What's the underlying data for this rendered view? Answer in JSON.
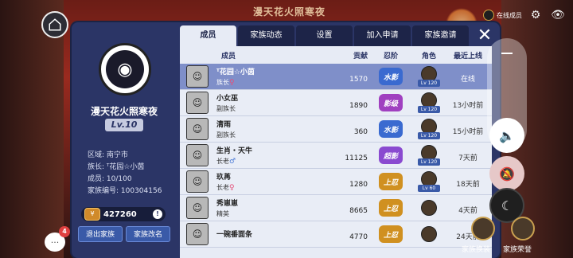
{
  "background": {
    "title": "漫天花火照寒夜"
  },
  "top_right": {
    "online_label": "在线成员",
    "settings_icon": "gear-icon",
    "eye_icon": "eye-icon"
  },
  "family": {
    "name": "漫天花火照寒夜",
    "level": "Lv.10",
    "info": [
      "区域: 南宁市",
      "族长: ᵀ花园☆小茵",
      "成员: 10/100",
      "家族编号: 100304156"
    ],
    "coins": "427260",
    "exit_label": "退出家族",
    "rename_label": "家族改名"
  },
  "tabs": [
    {
      "label": "成员",
      "active": true
    },
    {
      "label": "家族动态",
      "active": false
    },
    {
      "label": "设置",
      "active": false
    },
    {
      "label": "加入申请",
      "active": false
    },
    {
      "label": "家族邀请",
      "active": false
    }
  ],
  "table": {
    "headers": {
      "member": "成员",
      "contrib": "贡献",
      "rank": "忍阶",
      "char": "角色",
      "last": "最近上线"
    },
    "rows": [
      {
        "name": "ᵀ花园☆小茵",
        "role": "族长",
        "gender": "♀",
        "contrib": "1570",
        "rank": "水影",
        "lv": "Lv 120",
        "last": "在线",
        "highlight": true,
        "rank_color": "#3a6ad0"
      },
      {
        "name": "小女巫",
        "role": "副族长",
        "gender": "",
        "contrib": "1890",
        "rank": "影级",
        "lv": "Lv 120",
        "last": "13小时前",
        "highlight": false,
        "rank_color": "#a040c0"
      },
      {
        "name": "清雨",
        "role": "副族长",
        "gender": "",
        "contrib": "360",
        "rank": "水影",
        "lv": "Lv 120",
        "last": "15小时前",
        "highlight": false,
        "rank_color": "#3a6ad0"
      },
      {
        "name": "生肖・天牛",
        "role": "长老",
        "gender": "♂",
        "contrib": "11125",
        "rank": "超影",
        "lv": "Lv 120",
        "last": "7天前",
        "highlight": false,
        "rank_color": "#8a4ad0"
      },
      {
        "name": "玖苒",
        "role": "长老",
        "gender": "♀",
        "contrib": "1280",
        "rank": "上忍",
        "lv": "Lv 60",
        "last": "18天前",
        "highlight": false,
        "rank_color": "#d09020"
      },
      {
        "name": "秀崽崽",
        "role": "精英",
        "gender": "",
        "contrib": "8665",
        "rank": "上忍",
        "lv": "",
        "last": "4天前",
        "highlight": false,
        "rank_color": "#d09020"
      },
      {
        "name": "一碗番面条",
        "role": "",
        "gender": "",
        "contrib": "4770",
        "rank": "上忍",
        "lv": "",
        "last": "24天前",
        "highlight": false,
        "rank_color": "#d09020"
      }
    ]
  },
  "side_controls": {
    "volume_icon": "speaker-icon",
    "mute_icon": "bell-off-icon",
    "dnd_icon": "moon-icon"
  },
  "bottom": {
    "family_skin": "家族换装",
    "family_honor": "家族荣誉",
    "chat_count": "4"
  }
}
